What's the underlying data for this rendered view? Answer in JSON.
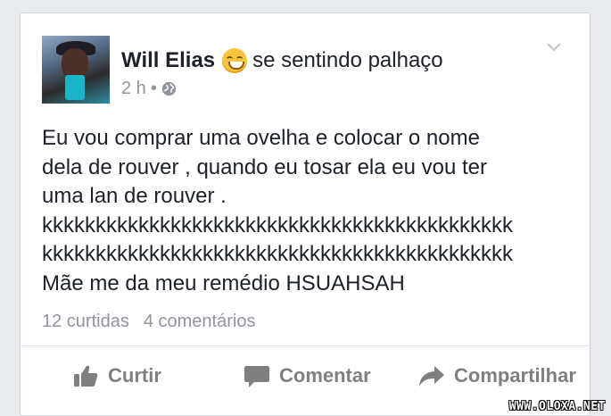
{
  "post": {
    "author": "Will Elias",
    "feeling_icon": "grinning-face-icon",
    "feeling_text": "se sentindo palhaço",
    "timestamp": "2 h",
    "separator": "•",
    "privacy_icon": "globe-icon",
    "menu_icon": "chevron-down-icon",
    "text_lines": [
      "Eu vou comprar uma ovelha e colocar o nome",
      "dela de rouver , quando eu tosar ela eu vou ter",
      "uma lan de rouver .",
      "kkkkkkkkkkkkkkkkkkkkkkkkkkkkkkkkkkkkkkkkkkkk",
      "kkkkkkkkkkkkkkkkkkkkkkkkkkkkkkkkkkkkkkkkkkkk",
      "Mãe me da meu remédio HSUAHSAH"
    ],
    "likes": "12 curtidas",
    "comments": "4 comentários"
  },
  "actions": {
    "like_label": "Curtir",
    "like_icon": "thumbs-up-icon",
    "comment_label": "Comentar",
    "comment_icon": "speech-bubble-icon",
    "share_label": "Compartilhar",
    "share_icon": "share-arrow-icon"
  },
  "watermark": "WWW.OLOXA.NET",
  "colors": {
    "background": "#e9eaed",
    "card": "#ffffff",
    "text": "#1d2129",
    "meta": "#90949c",
    "action": "#7f7f7f"
  }
}
